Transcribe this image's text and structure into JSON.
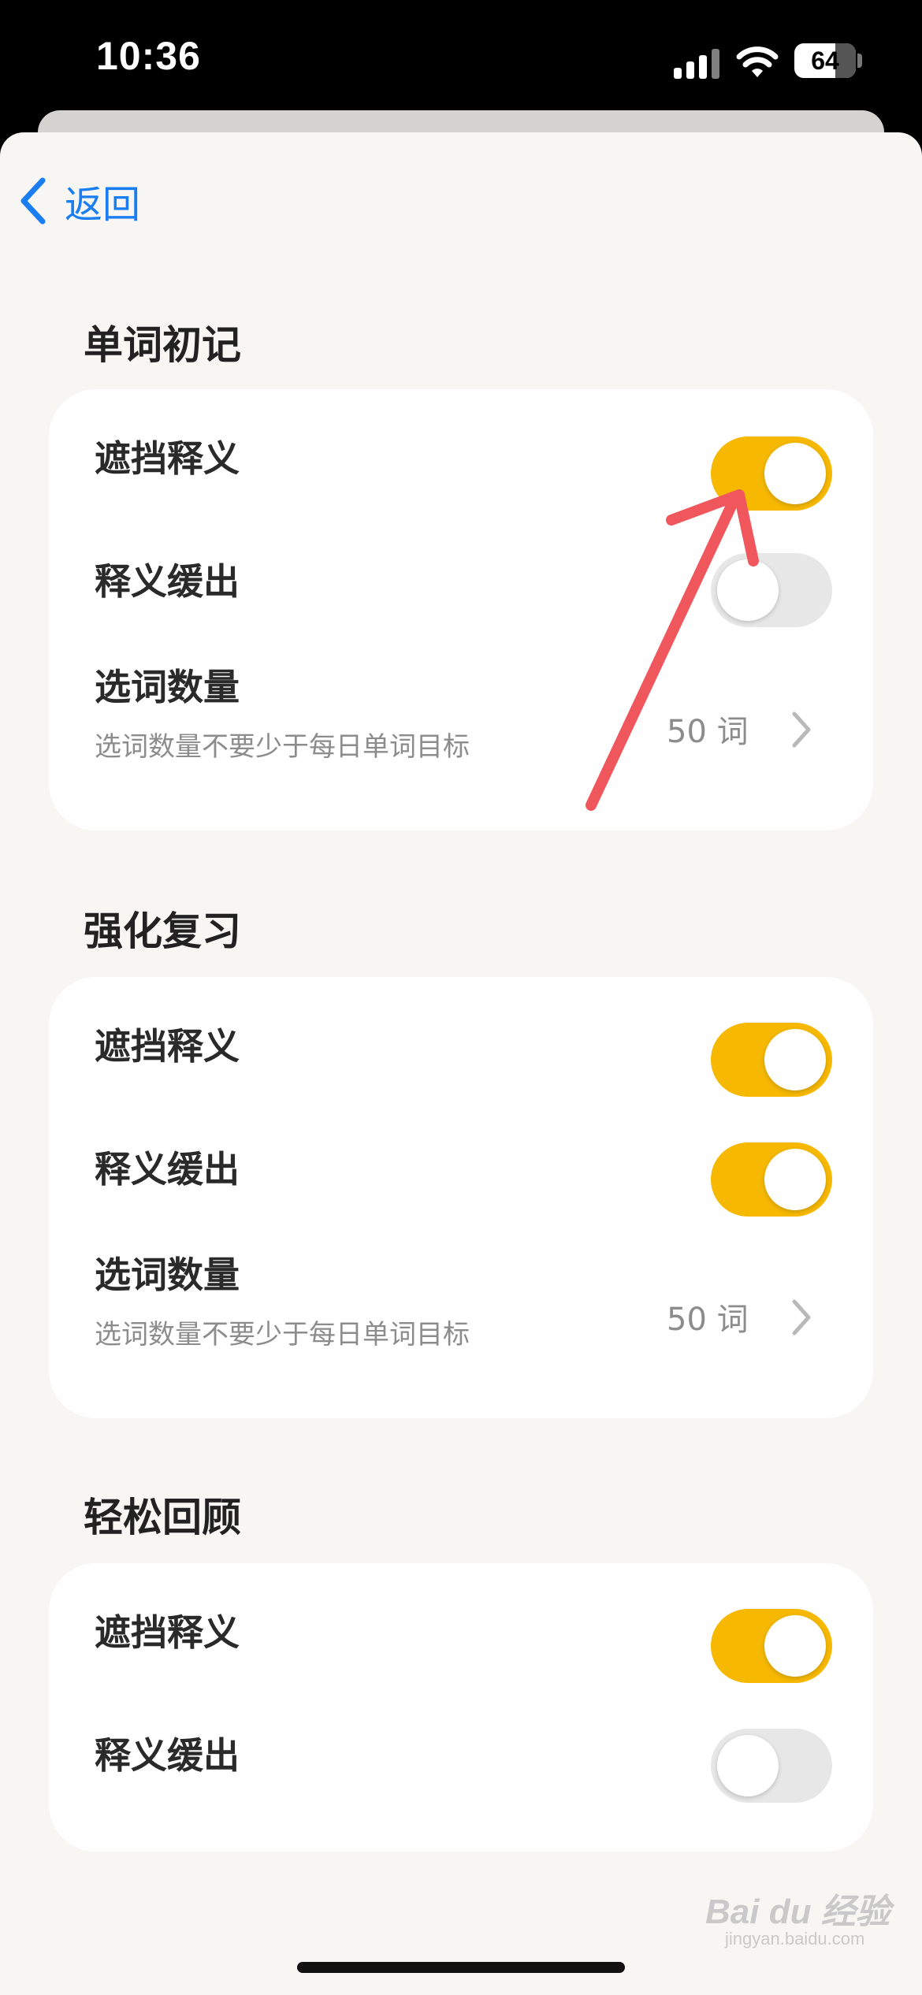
{
  "status_bar": {
    "time": "10:36",
    "battery": "64"
  },
  "nav": {
    "back_label": "返回"
  },
  "sections": [
    {
      "title": "单词初记",
      "rows": [
        {
          "label": "遮挡释义",
          "toggle_on": true
        },
        {
          "label": "释义缓出",
          "toggle_on": false
        },
        {
          "label": "选词数量",
          "subtitle": "选词数量不要少于每日单词目标",
          "value": "50 词"
        }
      ]
    },
    {
      "title": "强化复习",
      "rows": [
        {
          "label": "遮挡释义",
          "toggle_on": true
        },
        {
          "label": "释义缓出",
          "toggle_on": true
        },
        {
          "label": "选词数量",
          "subtitle": "选词数量不要少于每日单词目标",
          "value": "50 词"
        }
      ]
    },
    {
      "title": "轻松回顾",
      "rows": [
        {
          "label": "遮挡释义",
          "toggle_on": true
        },
        {
          "label": "释义缓出",
          "toggle_on": false
        }
      ]
    }
  ],
  "watermark": {
    "text": "Bai du 经验",
    "sub": "jingyan.baidu.com"
  },
  "colors": {
    "accent": "#f6b800",
    "link": "#1a7ef2",
    "background": "#f7f6f3",
    "annotation_arrow": "#f0575c"
  }
}
